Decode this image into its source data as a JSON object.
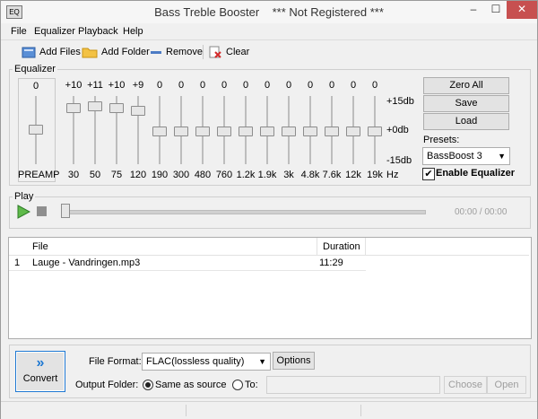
{
  "window": {
    "title": "Bass Treble Booster",
    "subtitle": "*** Not Registered ***",
    "minimize": "–",
    "maximize": "☐",
    "close": "✕"
  },
  "menu": [
    "File",
    "Equalizer",
    "Playback",
    "Help"
  ],
  "toolbar": {
    "add_files": "Add Files",
    "add_folder": "Add Folder",
    "remove": "Remove",
    "clear": "Clear"
  },
  "equalizer": {
    "label": "Equalizer",
    "preamp": {
      "label": "PREAMP",
      "value": "0"
    },
    "bands": [
      {
        "freq": "30",
        "value": "+10"
      },
      {
        "freq": "50",
        "value": "+11"
      },
      {
        "freq": "75",
        "value": "+10"
      },
      {
        "freq": "120",
        "value": "+9"
      },
      {
        "freq": "190",
        "value": "0"
      },
      {
        "freq": "300",
        "value": "0"
      },
      {
        "freq": "480",
        "value": "0"
      },
      {
        "freq": "760",
        "value": "0"
      },
      {
        "freq": "1.2k",
        "value": "0"
      },
      {
        "freq": "1.9k",
        "value": "0"
      },
      {
        "freq": "3k",
        "value": "0"
      },
      {
        "freq": "4.8k",
        "value": "0"
      },
      {
        "freq": "7.6k",
        "value": "0"
      },
      {
        "freq": "12k",
        "value": "0"
      },
      {
        "freq": "19k",
        "value": "0"
      }
    ],
    "scale_top": "+15db",
    "scale_mid": "+0db",
    "scale_bottom": "-15db",
    "hz": "Hz",
    "zero_all": "Zero All",
    "save": "Save",
    "load": "Load",
    "presets_label": "Presets:",
    "preset": "BassBoost 3",
    "enable_label": "Enable Equalizer",
    "enabled": true
  },
  "play": {
    "label": "Play",
    "time": "00:00 / 00:00",
    "progress": 0
  },
  "files": {
    "columns": [
      "File",
      "Duration"
    ],
    "rows": [
      {
        "index": "1",
        "file": "Lauge - Vandringen.mp3",
        "duration": "11:29"
      }
    ]
  },
  "output": {
    "convert": "Convert",
    "format_label": "File Format:",
    "format": "FLAC(lossless quality)",
    "options": "Options",
    "folder_label": "Output Folder:",
    "same_as_source": "Same as source",
    "to_label": "To:",
    "to_path": "",
    "choose": "Choose",
    "open": "Open"
  },
  "colors": {
    "accent": "#1e78d2",
    "play_green": "#3aa53a",
    "disabled_text": "#9d9d9d"
  }
}
